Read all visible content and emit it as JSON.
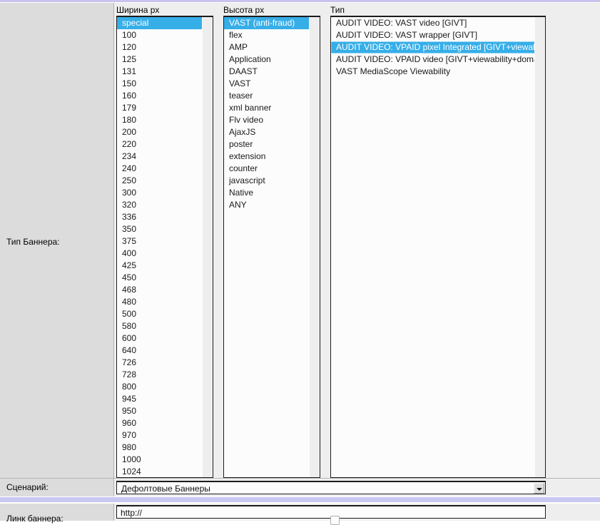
{
  "form": {
    "banner_type_label": "Тип Баннера:",
    "scenario_label": "Сценарий:",
    "banner_link_label": "Линк баннера:",
    "scenario_value": "Дефолтовые Баннеры",
    "banner_link_value": "http://"
  },
  "columns": {
    "width": {
      "header": "Ширина px",
      "selected": "special",
      "items": [
        "special",
        "100",
        "120",
        "125",
        "131",
        "150",
        "160",
        "179",
        "180",
        "200",
        "220",
        "234",
        "240",
        "250",
        "300",
        "320",
        "336",
        "350",
        "375",
        "400",
        "425",
        "450",
        "468",
        "480",
        "500",
        "580",
        "600",
        "640",
        "726",
        "728",
        "800",
        "945",
        "950",
        "960",
        "970",
        "980",
        "1000",
        "1024"
      ]
    },
    "height": {
      "header": "Высота px",
      "selected": "VAST (anti-fraud)",
      "items": [
        "VAST (anti-fraud)",
        "flex",
        "AMP",
        "Application",
        "DAAST",
        "VAST",
        "teaser",
        "xml banner",
        "Flv video",
        "AjaxJS",
        "poster",
        "extension",
        "counter",
        "javascript",
        "Native",
        "ANY"
      ]
    },
    "type": {
      "header": "Тип",
      "selected": "AUDIT VIDEO: VPAID pixel Integrated [GIVT+viewability]",
      "items": [
        "AUDIT VIDEO: VAST video [GIVT]",
        "AUDIT VIDEO: VAST wrapper [GIVT]",
        "AUDIT VIDEO: VPAID pixel Integrated [GIVT+viewability]",
        "AUDIT VIDEO: VPAID video [GIVT+viewability+domain]",
        "VAST MediaScope Viewability"
      ]
    }
  },
  "colors": {
    "selection": "#36aee8",
    "panel": "#eeeeee",
    "label_cell": "#dcdcdc",
    "divider_lavender": "#c9c8f2"
  }
}
